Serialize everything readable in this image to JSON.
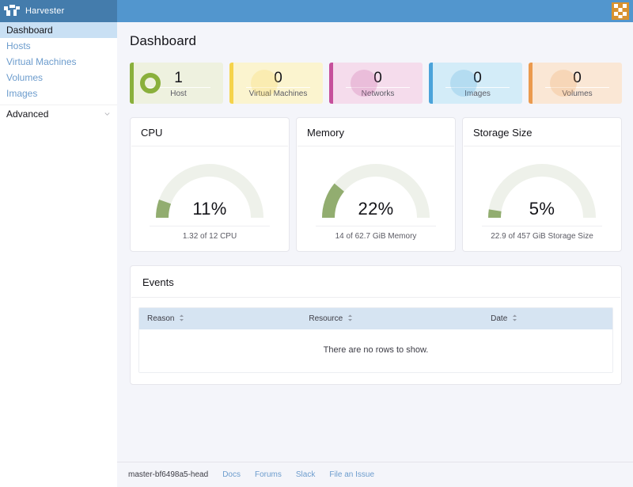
{
  "header": {
    "brand_name": "Harvester",
    "brand_logo_icon": "harvester-logo-icon",
    "cluster_icon": "harvester-cluster-icon",
    "brand_bg": "#447cac",
    "bar_bg": "#5296ce",
    "cluster_icon_color": "#d8922f"
  },
  "sidebar": {
    "items": [
      {
        "label": "Dashboard",
        "active": true
      },
      {
        "label": "Hosts",
        "active": false
      },
      {
        "label": "Virtual Machines",
        "active": false
      },
      {
        "label": "Volumes",
        "active": false
      },
      {
        "label": "Images",
        "active": false
      }
    ],
    "group": {
      "label": "Advanced",
      "icon": "chevron-down-icon"
    },
    "active_bg": "#c9e0f4",
    "link_color": "#6c9ccd"
  },
  "main": {
    "page_title": "Dashboard"
  },
  "stats": [
    {
      "value": "1",
      "label": "Host",
      "accent": "#8ab03c",
      "bg": "#eef1df",
      "has_ring": true
    },
    {
      "value": "0",
      "label": "Virtual Machines",
      "accent": "#f5d34b",
      "bg": "#fbf4cf",
      "has_ring": false
    },
    {
      "value": "0",
      "label": "Networks",
      "accent": "#c6509b",
      "bg": "#f5dcec",
      "has_ring": false
    },
    {
      "value": "0",
      "label": "Images",
      "accent": "#4ba3da",
      "bg": "#d3ecf8",
      "has_ring": false
    },
    {
      "value": "0",
      "label": "Volumes",
      "accent": "#eb9a4e",
      "bg": "#fae7d5",
      "has_ring": false
    }
  ],
  "gauges": [
    {
      "title": "CPU",
      "percent": "11%",
      "value": 11,
      "footer": "1.32 of 12 CPU"
    },
    {
      "title": "Memory",
      "percent": "22%",
      "value": 22,
      "footer": "14 of 62.7 GiB Memory"
    },
    {
      "title": "Storage Size",
      "percent": "5%",
      "value": 5,
      "footer": "22.9 of 457 GiB Storage Size"
    }
  ],
  "gauge_style": {
    "track_color": "#eef1ea",
    "fill_color": "#92ad70"
  },
  "events": {
    "title": "Events",
    "columns": [
      {
        "label": "Reason",
        "icon": "sort-icon",
        "align": "left"
      },
      {
        "label": "Resource",
        "icon": "sort-icon",
        "align": "left"
      },
      {
        "label": "Date",
        "icon": "sort-icon",
        "align": "right"
      }
    ],
    "empty_message": "There are no rows to show.",
    "header_bg": "#d6e4f2"
  },
  "footer": {
    "version": "master-bf6498a5-head",
    "links": [
      {
        "label": "Docs"
      },
      {
        "label": "Forums"
      },
      {
        "label": "Slack"
      },
      {
        "label": "File an Issue"
      }
    ]
  }
}
